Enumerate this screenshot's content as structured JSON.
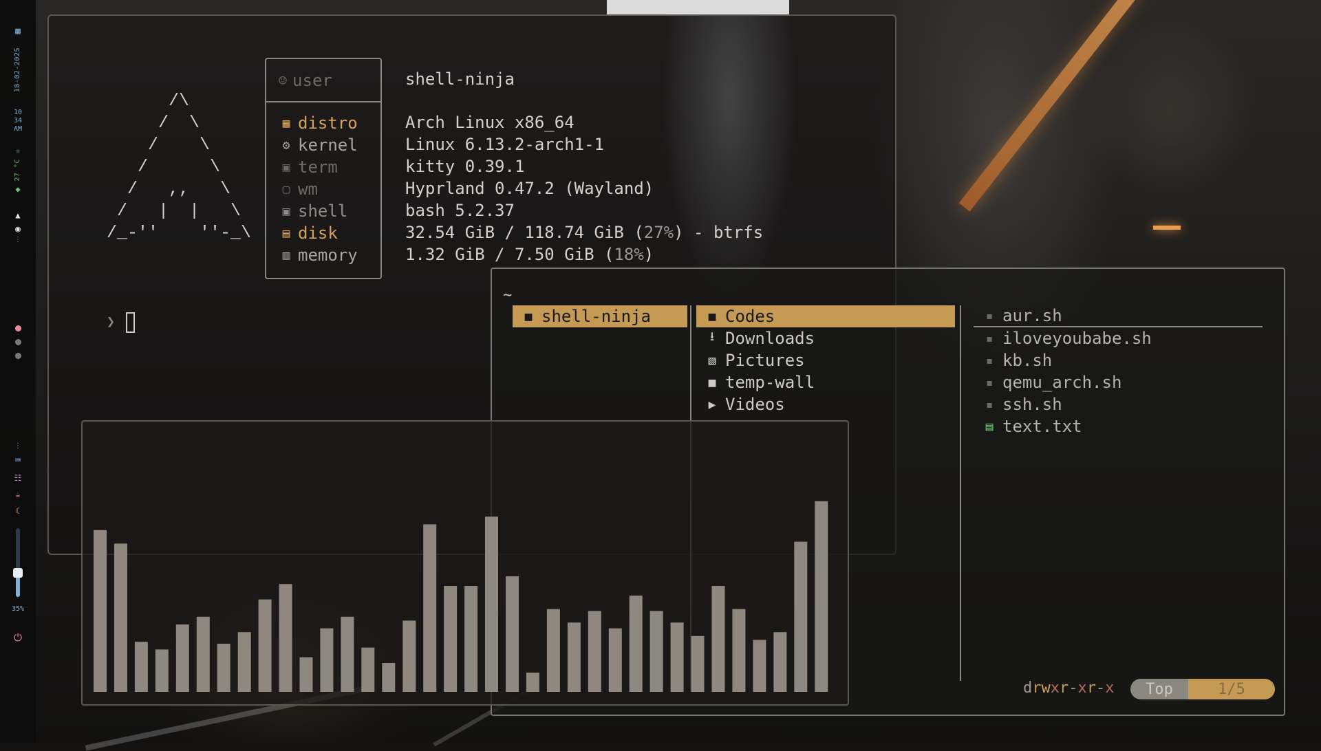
{
  "sidebar": {
    "workspace_icon": "grid-icon",
    "date": "18-02-2025",
    "time_hour": "10",
    "time_minute": "34",
    "time_period": "AM",
    "temperature": "27 °C",
    "brightness_percent": "35%",
    "workspaces": [
      {
        "active": true
      },
      {
        "active": false
      },
      {
        "active": false
      }
    ],
    "accent": "#7fb0d8"
  },
  "fetch": {
    "ascii_art": "      /\\\n     /  \\\n    /    \\\n   /      \\\n  /   ,,   \\\n /   |  |   \\\n/_-''    ''-_\\",
    "user_label": "user",
    "user_value": "shell-ninja",
    "rows": [
      {
        "label": "distro",
        "value": "Arch Linux x86_64",
        "color": "#d6a15a",
        "icon": "distro-icon"
      },
      {
        "label": "kernel",
        "value": "Linux 6.13.2-arch1-1",
        "color": "#a9a49d",
        "icon": "gear-icon"
      },
      {
        "label": "term",
        "value": "kitty 0.39.1",
        "color": "#6e6a65",
        "icon": "terminal-icon"
      },
      {
        "label": "wm",
        "value": "Hyprland 0.47.2 (Wayland)",
        "color": "#6e6a65",
        "icon": "window-icon"
      },
      {
        "label": "shell",
        "value": "bash 5.2.37",
        "color": "#8f8a84",
        "icon": "shell-icon"
      },
      {
        "label": "disk",
        "value_main": "32.54 GiB / 118.74 GiB (",
        "value_pct": "27%",
        "value_tail": ") - btrfs",
        "color": "#d6a15a",
        "icon": "disk-icon"
      },
      {
        "label": "memory",
        "value_main": "1.32 GiB / 7.50 GiB (",
        "value_pct": "18%",
        "value_tail": ")",
        "color": "#a9a49d",
        "icon": "memory-icon"
      }
    ],
    "prompt_symbol": "❯"
  },
  "file_manager": {
    "path": "~",
    "parent": [
      {
        "name": "shell-ninja",
        "selected": true
      }
    ],
    "current": [
      {
        "name": "Codes",
        "icon": "folder-icon",
        "selected": true
      },
      {
        "name": "Downloads",
        "icon": "download-folder-icon",
        "selected": false
      },
      {
        "name": "Pictures",
        "icon": "picture-folder-icon",
        "selected": false
      },
      {
        "name": "temp-wall",
        "icon": "folder-icon",
        "selected": false
      },
      {
        "name": "Videos",
        "icon": "video-folder-icon",
        "selected": false
      }
    ],
    "preview": [
      {
        "name": "aur.sh",
        "icon": "script-icon"
      },
      {
        "name": "iloveyoubabe.sh",
        "icon": "script-icon"
      },
      {
        "name": "kb.sh",
        "icon": "script-icon"
      },
      {
        "name": "qemu_arch.sh",
        "icon": "script-icon"
      },
      {
        "name": "ssh.sh",
        "icon": "script-icon"
      },
      {
        "name": "text.txt",
        "icon": "text-file-icon"
      }
    ],
    "permissions": "drwxr-xr-x",
    "position_label": "Top",
    "position_count": "1/5",
    "accent": "#c49a54"
  },
  "chart_data": {
    "type": "bar",
    "values": [
      0.84,
      0.77,
      0.26,
      0.22,
      0.35,
      0.39,
      0.25,
      0.31,
      0.48,
      0.56,
      0.18,
      0.33,
      0.39,
      0.23,
      0.15,
      0.37,
      0.87,
      0.55,
      0.55,
      0.91,
      0.6,
      0.1,
      0.43,
      0.36,
      0.42,
      0.33,
      0.5,
      0.42,
      0.36,
      0.29,
      0.55,
      0.43,
      0.27,
      0.31,
      0.78,
      0.99
    ],
    "ylim": [
      0,
      1
    ],
    "grid": false
  }
}
